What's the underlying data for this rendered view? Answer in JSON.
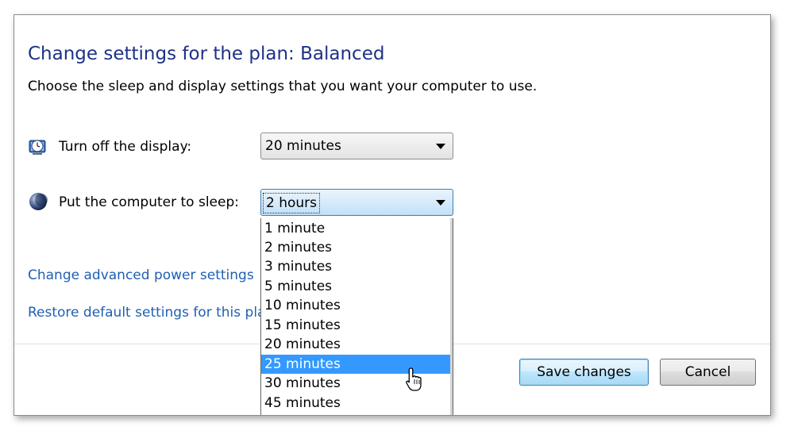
{
  "page": {
    "title": "Change settings for the plan: Balanced",
    "subtitle": "Choose the sleep and display settings that you want your computer to use."
  },
  "settings": [
    {
      "label": "Turn off the display:",
      "value": "20 minutes",
      "icon": "monitor-clock-icon"
    },
    {
      "label": "Put the computer to sleep:",
      "value": "2 hours",
      "icon": "moon-sleep-icon"
    }
  ],
  "links": {
    "advanced": "Change advanced power settings",
    "restore": "Restore default settings for this pla"
  },
  "dropdown": {
    "options": [
      "1 minute",
      "2 minutes",
      "3 minutes",
      "5 minutes",
      "10 minutes",
      "15 minutes",
      "20 minutes",
      "25 minutes",
      "30 minutes",
      "45 minutes"
    ],
    "highlighted": "25 minutes"
  },
  "buttons": {
    "save": "Save changes",
    "cancel": "Cancel"
  },
  "colors": {
    "title": "#1e3287",
    "link": "#1f5fb4",
    "highlight": "#3399ff"
  },
  "icons": {
    "cursor": "mouse-pointer-icon",
    "dropdown_arrow": "chevron-down-icon"
  }
}
